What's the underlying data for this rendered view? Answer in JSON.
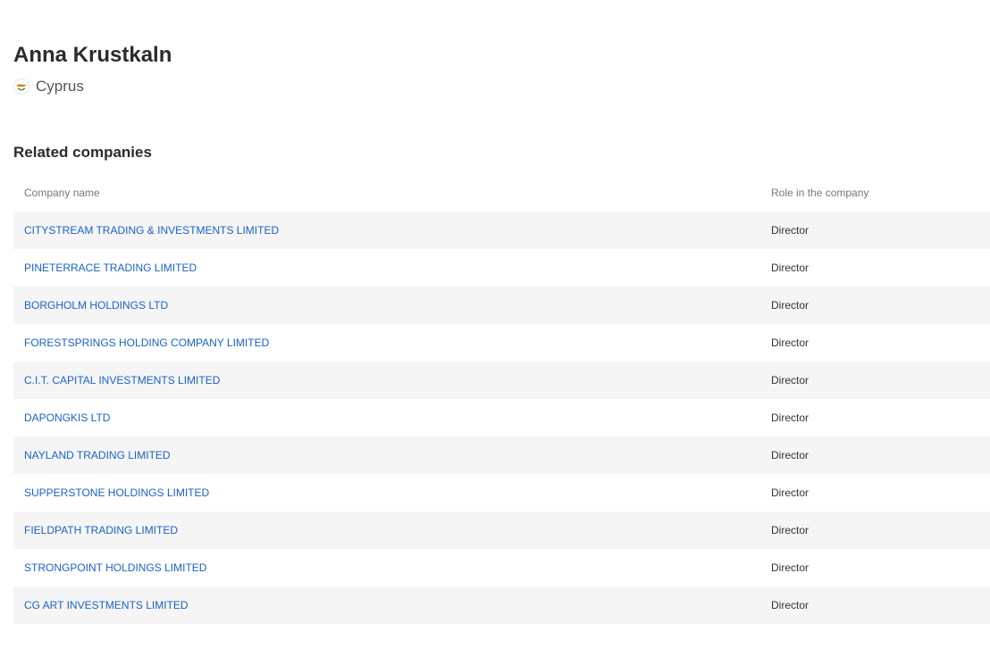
{
  "person": {
    "name": "Anna Krustkaln",
    "country": "Cyprus",
    "country_flag_icon": "cyprus-flag-icon"
  },
  "related": {
    "section_title": "Related companies",
    "columns": {
      "company_name": "Company name",
      "role": "Role in the company"
    },
    "rows": [
      {
        "company": "CITYSTREAM TRADING & INVESTMENTS LIMITED",
        "role": "Director"
      },
      {
        "company": "PINETERRACE TRADING LIMITED",
        "role": "Director"
      },
      {
        "company": "BORGHOLM HOLDINGS LTD",
        "role": "Director"
      },
      {
        "company": "FORESTSPRINGS HOLDING COMPANY LIMITED",
        "role": "Director"
      },
      {
        "company": "C.I.T. CAPITAL INVESTMENTS LIMITED",
        "role": "Director"
      },
      {
        "company": "DAPONGKIS LTD",
        "role": "Director"
      },
      {
        "company": "NAYLAND TRADING LIMITED",
        "role": "Director"
      },
      {
        "company": "SUPPERSTONE HOLDINGS LIMITED",
        "role": "Director"
      },
      {
        "company": "FIELDPATH TRADING LIMITED",
        "role": "Director"
      },
      {
        "company": "STRONGPOINT HOLDINGS LIMITED",
        "role": "Director"
      },
      {
        "company": "CG ART INVESTMENTS LIMITED",
        "role": "Director"
      }
    ]
  },
  "colors": {
    "link": "#1a62c7",
    "row_shade": "#f5f5f5",
    "heading": "#2b2b2b"
  }
}
